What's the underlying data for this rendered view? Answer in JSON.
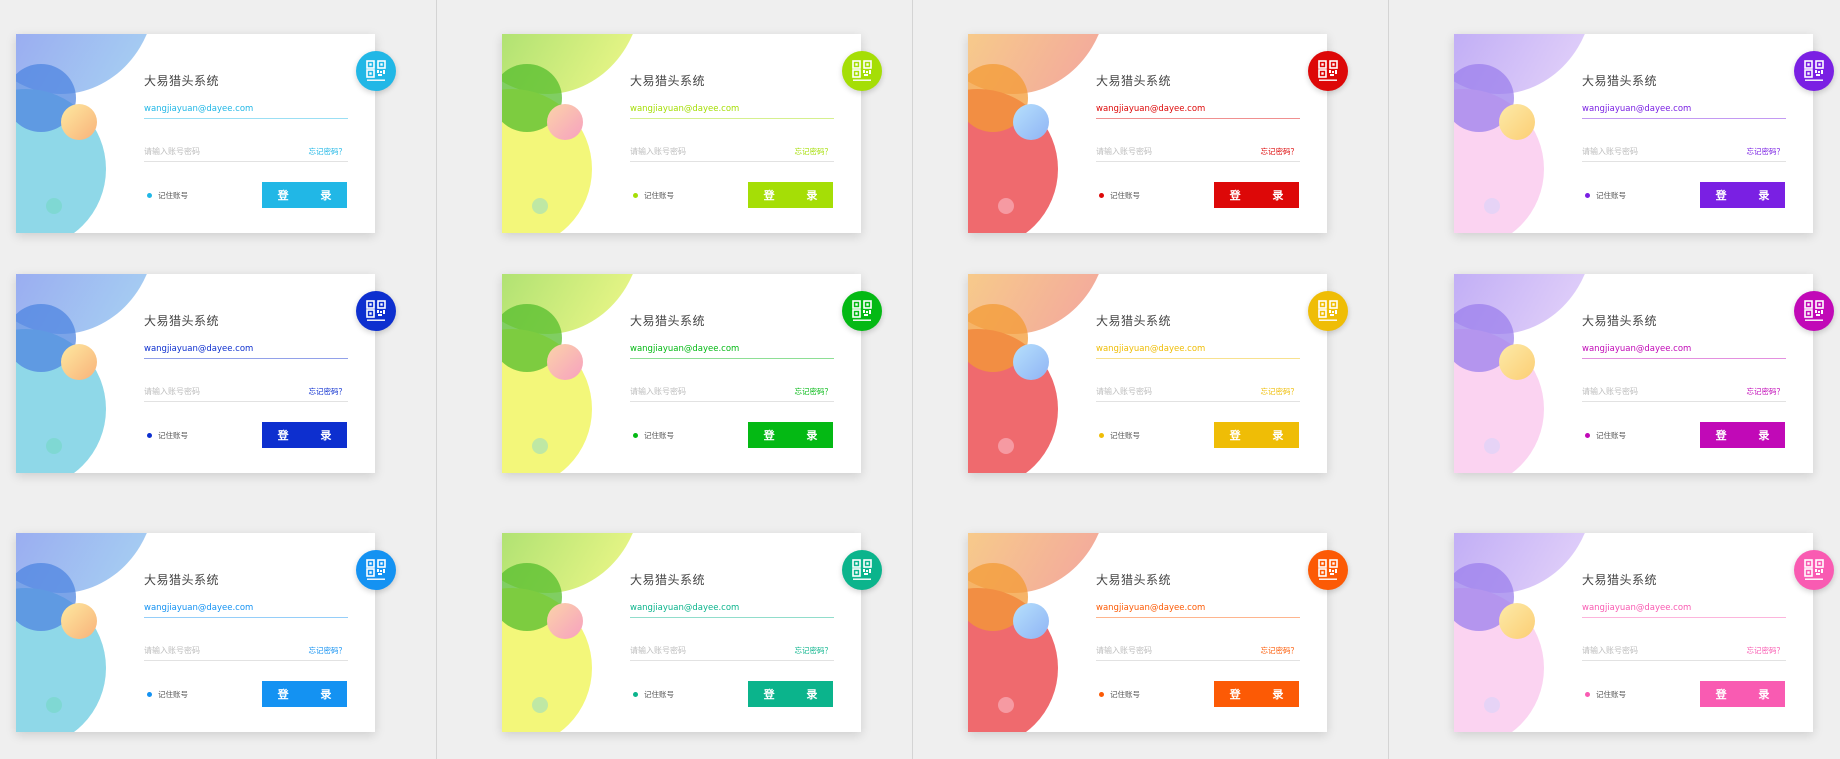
{
  "card_text": {
    "title": "大易猎头系统",
    "username_value": "wangjiayuan@dayee.com",
    "password_placeholder": "请输入账号密码",
    "forgot_label": "忘记密码？",
    "remember_label": "记住账号",
    "login_label": "登 录",
    "qr_icon": "qr-code-scan-icon"
  },
  "columns": [
    {
      "palette": "blue-purple",
      "colors": {
        "top_a": "#8f8ff0",
        "top_b": "#a8d4f2",
        "mid": "#4f86e0",
        "big": "#8fd8e8",
        "ball_a": "#fde9a0",
        "ball_b": "#f9b27a",
        "dot": "#7fd8d3"
      },
      "cards": [
        {
          "accent": "#21b7e6"
        },
        {
          "accent": "#0d2fcf"
        },
        {
          "accent": "#1492f2"
        }
      ]
    },
    {
      "palette": "green-yellow",
      "colors": {
        "top_a": "#7cd060",
        "top_b": "#f3f98a",
        "mid": "#56bd2e",
        "big": "#f3f77a",
        "ball_a": "#fbd3a8",
        "ball_b": "#f7a0c0",
        "dot": "#bfe8a4"
      },
      "cards": [
        {
          "accent": "#a5de06"
        },
        {
          "accent": "#04b914"
        },
        {
          "accent": "#0bb48c"
        }
      ]
    },
    {
      "palette": "yellow-red",
      "colors": {
        "top_a": "#fbe97a",
        "top_b": "#f2a3a0",
        "mid": "#f39b35",
        "big": "#ef6a6e",
        "ball_a": "#b6e0fc",
        "ball_b": "#8fb4f5",
        "dot": "#f69aa2"
      },
      "cards": [
        {
          "accent": "#dd0808"
        },
        {
          "accent": "#efbd06"
        },
        {
          "accent": "#fc5a05"
        }
      ]
    },
    {
      "palette": "purple-pink",
      "colors": {
        "top_a": "#a590f2",
        "top_b": "#e6d5fa",
        "mid": "#9c80ec",
        "big": "#fbd3f1",
        "ball_a": "#fdeaa8",
        "ball_b": "#fbce74",
        "dot": "#e6d3f6"
      },
      "cards": [
        {
          "accent": "#7a20e3"
        },
        {
          "accent": "#c109b7"
        },
        {
          "accent": "#f95bb2"
        }
      ]
    }
  ]
}
